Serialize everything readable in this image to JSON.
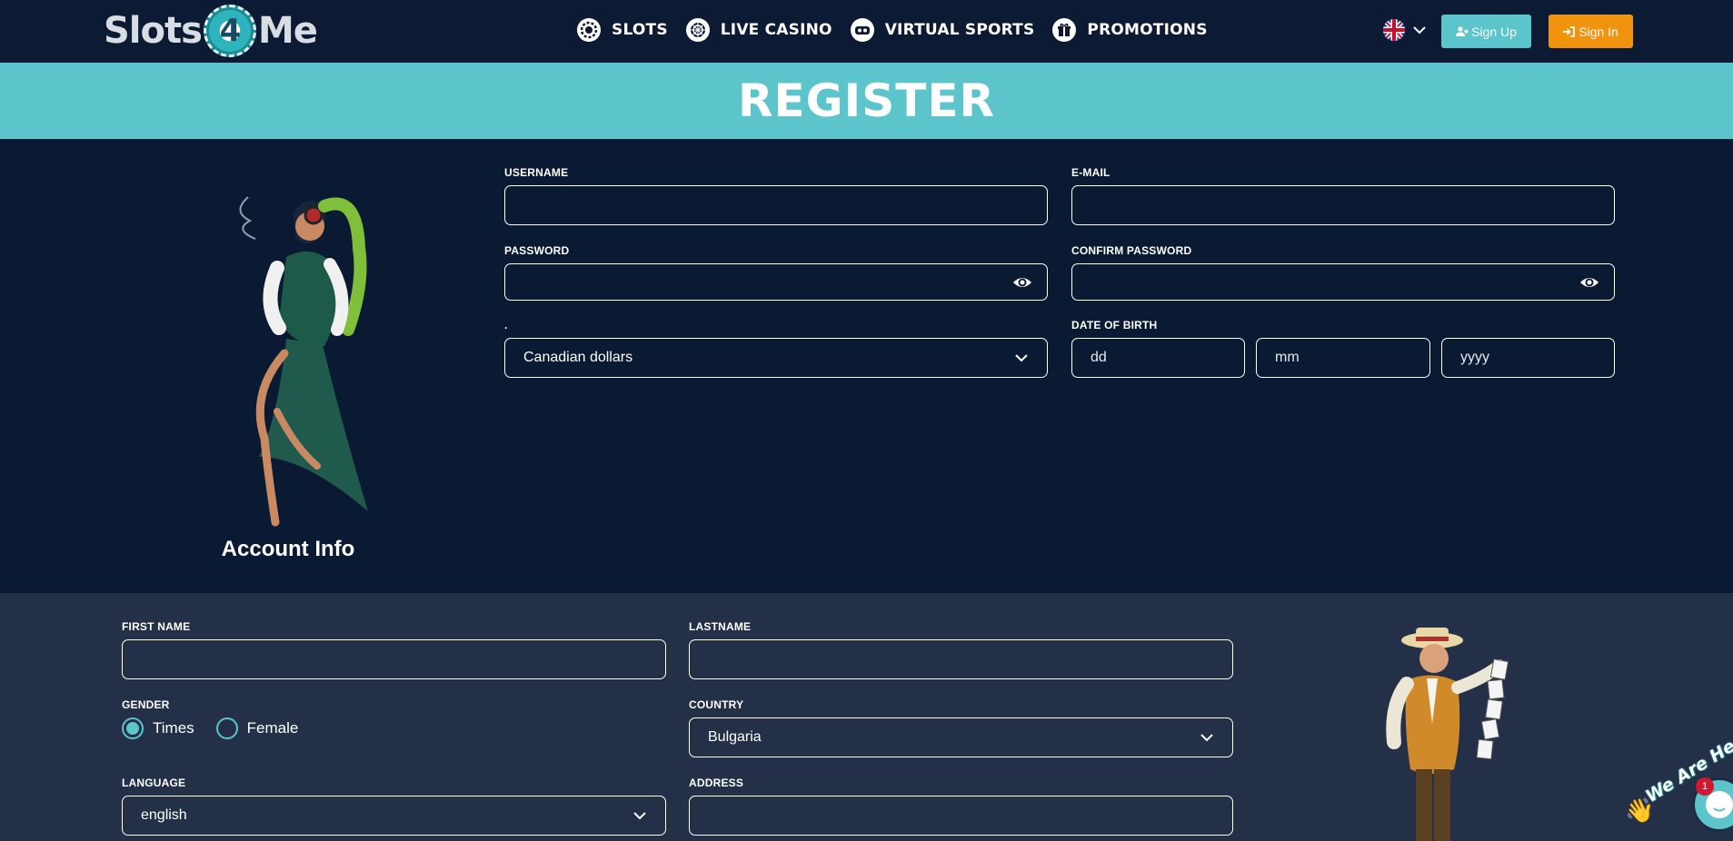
{
  "header": {
    "logo": {
      "part1": "Slots",
      "chip": "4",
      "part2": "Me"
    },
    "nav": [
      {
        "label": "SLOTS",
        "icon": "slots-chip-icon"
      },
      {
        "label": "LIVE CASINO",
        "icon": "roulette-icon"
      },
      {
        "label": "VIRTUAL SPORTS",
        "icon": "vr-headset-icon"
      },
      {
        "label": "PROMOTIONS",
        "icon": "gift-icon"
      }
    ],
    "signup_label": "Sign Up",
    "signin_label": "Sign In"
  },
  "banner": {
    "title": "REGISTER"
  },
  "account": {
    "title": "Account Info",
    "username_label": "USERNAME",
    "email_label": "E-MAIL",
    "password_label": "PASSWORD",
    "confirm_password_label": "CONFIRM PASSWORD",
    "currency_label": ".",
    "currency_value": "Canadian dollars",
    "dob_label": "DATE OF BIRTH",
    "dob_day_placeholder": "dd",
    "dob_month_placeholder": "mm",
    "dob_year_placeholder": "yyyy"
  },
  "personal": {
    "first_name_label": "FIRST NAME",
    "last_name_label": "LASTNAME",
    "gender_label": "GENDER",
    "gender_options": [
      "Times",
      "Female"
    ],
    "gender_selected": "Times",
    "country_label": "COUNTRY",
    "country_value": "Bulgaria",
    "language_label": "LANGUAGE",
    "language_value": "english",
    "address_label": "ADDRESS"
  },
  "chat": {
    "text": "We Are Here!",
    "badge": "1"
  },
  "colors": {
    "background": "#0b1a33",
    "section2": "#243047",
    "accent": "#5cc4cb",
    "signin": "#f0930f"
  }
}
